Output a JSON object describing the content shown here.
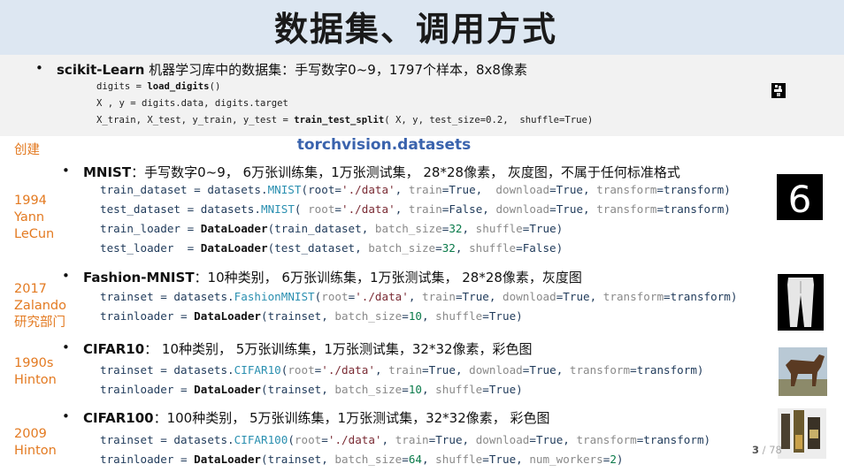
{
  "title": "数据集、调用方式",
  "sklearn": {
    "name": "scikit-Learn",
    "desc": " 机器学习库中的数据集：手写数字0~9，1797个样本，8x8像素",
    "lines": [
      [
        "digits = ",
        {
          "f": "load_digits"
        },
        "()"
      ],
      [
        "X , y = digits.data, digits.target"
      ],
      [
        "X_train, X_test, y_train, y_test = ",
        {
          "f": "train_test_split"
        },
        "( X, y, test_size=0.2,  shuffle=True)"
      ]
    ]
  },
  "torchvision_title": "torchvision.datasets",
  "side_labels": [
    {
      "id": "created",
      "lines": [
        "创建"
      ]
    },
    {
      "id": "mnist",
      "lines": [
        "1994",
        "Yann",
        "LeCun"
      ]
    },
    {
      "id": "fashion",
      "lines": [
        "2017",
        "Zalando",
        "研究部门"
      ]
    },
    {
      "id": "cifar10",
      "lines": [
        "1990s",
        "Hinton"
      ]
    },
    {
      "id": "cifar100",
      "lines": [
        "2009",
        "Hinton"
      ]
    }
  ],
  "datasets": [
    {
      "id": "mnist",
      "name": "MNIST",
      "desc": "：手写数字0~9， 6万张训练集，1万张测试集， 28*28像素， 灰度图，不属于任何标准格式",
      "code": [
        [
          [
            "t",
            "train_dataset = datasets."
          ],
          [
            "c",
            "MNIST"
          ],
          [
            "t",
            "(root="
          ],
          [
            "s",
            "'./data'"
          ],
          [
            "t",
            ", "
          ],
          [
            "v",
            "train"
          ],
          [
            "t",
            "=True,  "
          ],
          [
            "v",
            "download"
          ],
          [
            "t",
            "=True, "
          ],
          [
            "v",
            "transform"
          ],
          [
            "t",
            "=transform)"
          ]
        ],
        [
          [
            "t",
            "test_dataset = datasets."
          ],
          [
            "c",
            "MNIST"
          ],
          [
            "t",
            "( "
          ],
          [
            "v",
            "root"
          ],
          [
            "t",
            "="
          ],
          [
            "s",
            "'./data'"
          ],
          [
            "t",
            ", "
          ],
          [
            "v",
            "train"
          ],
          [
            "t",
            "=False, "
          ],
          [
            "v",
            "download"
          ],
          [
            "t",
            "=True, "
          ],
          [
            "v",
            "transform"
          ],
          [
            "t",
            "=transform)"
          ]
        ],
        [
          [
            "t",
            "train_loader = "
          ],
          [
            "f",
            "DataLoader"
          ],
          [
            "t",
            "(train_dataset, "
          ],
          [
            "v",
            "batch_size"
          ],
          [
            "t",
            "="
          ],
          [
            "n",
            "32"
          ],
          [
            "t",
            ", "
          ],
          [
            "v",
            "shuffle"
          ],
          [
            "t",
            "=True)"
          ]
        ],
        [
          [
            "t",
            "test_loader  = "
          ],
          [
            "f",
            "DataLoader"
          ],
          [
            "t",
            "(test_dataset, "
          ],
          [
            "v",
            "batch_size"
          ],
          [
            "t",
            "="
          ],
          [
            "n",
            "32"
          ],
          [
            "t",
            ", "
          ],
          [
            "v",
            "shuffle"
          ],
          [
            "t",
            "=False)"
          ]
        ]
      ]
    },
    {
      "id": "fashion",
      "name": "Fashion-MNIST",
      "desc": "：10种类别， 6万张训练集，1万张测试集， 28*28像素，灰度图",
      "code": [
        [
          [
            "t",
            "trainset = datasets."
          ],
          [
            "c",
            "FashionMNIST"
          ],
          [
            "t",
            "("
          ],
          [
            "v",
            "root"
          ],
          [
            "t",
            "="
          ],
          [
            "s",
            "'./data'"
          ],
          [
            "t",
            ", "
          ],
          [
            "v",
            "train"
          ],
          [
            "t",
            "=True, "
          ],
          [
            "v",
            "download"
          ],
          [
            "t",
            "=True, "
          ],
          [
            "v",
            "transform"
          ],
          [
            "t",
            "=transform)"
          ]
        ],
        [
          [
            "t",
            "trainloader = "
          ],
          [
            "f",
            "DataLoader"
          ],
          [
            "t",
            "(trainset, "
          ],
          [
            "v",
            "batch_size"
          ],
          [
            "t",
            "="
          ],
          [
            "n",
            "10"
          ],
          [
            "t",
            ", "
          ],
          [
            "v",
            "shuffle"
          ],
          [
            "t",
            "=True)"
          ]
        ]
      ]
    },
    {
      "id": "cifar10",
      "name": "CIFAR10",
      "desc": "：     10种类别， 5万张训练集，1万张测试集，32*32像素，彩色图",
      "code": [
        [
          [
            "t",
            "trainset = datasets."
          ],
          [
            "c",
            "CIFAR10"
          ],
          [
            "t",
            "("
          ],
          [
            "v",
            "root"
          ],
          [
            "t",
            "="
          ],
          [
            "s",
            "'./data'"
          ],
          [
            "t",
            ", "
          ],
          [
            "v",
            "train"
          ],
          [
            "t",
            "=True, "
          ],
          [
            "v",
            "download"
          ],
          [
            "t",
            "=True, "
          ],
          [
            "v",
            "transform"
          ],
          [
            "t",
            "=transform)"
          ]
        ],
        [
          [
            "t",
            "trainloader = "
          ],
          [
            "f",
            "DataLoader"
          ],
          [
            "t",
            "(trainset, "
          ],
          [
            "v",
            "batch_size"
          ],
          [
            "t",
            "="
          ],
          [
            "n",
            "10"
          ],
          [
            "t",
            ", "
          ],
          [
            "v",
            "shuffle"
          ],
          [
            "t",
            "=True)"
          ]
        ]
      ]
    },
    {
      "id": "cifar100",
      "name": "CIFAR100",
      "desc": "：100种类别， 5万张训练集，1万张测试集，32*32像素， 彩色图",
      "code": [
        [
          [
            "t",
            "trainset = datasets."
          ],
          [
            "c",
            "CIFAR100"
          ],
          [
            "t",
            "("
          ],
          [
            "v",
            "root"
          ],
          [
            "t",
            "="
          ],
          [
            "s",
            "'./data'"
          ],
          [
            "t",
            ", "
          ],
          [
            "v",
            "train"
          ],
          [
            "t",
            "=True, "
          ],
          [
            "v",
            "download"
          ],
          [
            "t",
            "=True, "
          ],
          [
            "v",
            "transform"
          ],
          [
            "t",
            "=transform)"
          ]
        ],
        [
          [
            "t",
            "trainloader = "
          ],
          [
            "f",
            "DataLoader"
          ],
          [
            "t",
            "(trainset, "
          ],
          [
            "v",
            "batch_size"
          ],
          [
            "t",
            "="
          ],
          [
            "n",
            "64"
          ],
          [
            "t",
            ", "
          ],
          [
            "v",
            "shuffle"
          ],
          [
            "t",
            "=True, "
          ],
          [
            "v",
            "num_workers"
          ],
          [
            "t",
            "="
          ],
          [
            "n",
            "2"
          ],
          [
            "t",
            ")"
          ]
        ]
      ]
    }
  ],
  "page_number": "3",
  "page_total": " / 78",
  "thumb_digit": "6"
}
